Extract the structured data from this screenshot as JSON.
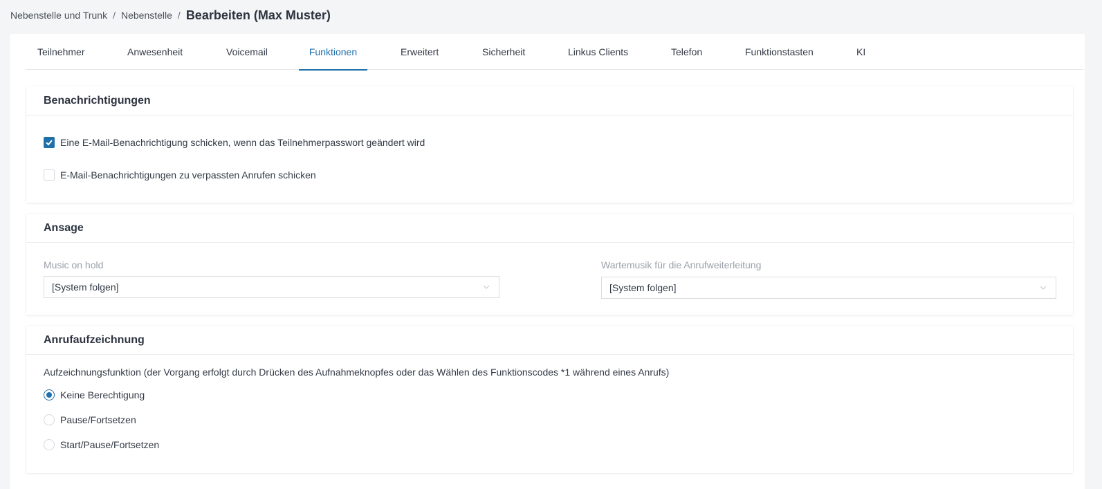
{
  "breadcrumb": {
    "items": [
      "Nebenstelle und Trunk",
      "Nebenstelle"
    ],
    "separator": "/",
    "current": "Bearbeiten (Max Muster)"
  },
  "tabs": [
    {
      "label": "Teilnehmer"
    },
    {
      "label": "Anwesenheit"
    },
    {
      "label": "Voicemail"
    },
    {
      "label": "Funktionen",
      "active": true
    },
    {
      "label": "Erweitert"
    },
    {
      "label": "Sicherheit"
    },
    {
      "label": "Linkus Clients"
    },
    {
      "label": "Telefon"
    },
    {
      "label": "Funktionstasten"
    },
    {
      "label": "KI"
    }
  ],
  "notifications": {
    "title": "Benachrichtigungen",
    "options": [
      {
        "label": "Eine E-Mail-Benachrichtigung schicken, wenn das Teilnehmerpasswort geändert wird",
        "checked": true
      },
      {
        "label": "E-Mail-Benachrichtigungen zu verpassten Anrufen schicken",
        "checked": false
      }
    ]
  },
  "announcement": {
    "title": "Ansage",
    "music_on_hold": {
      "label": "Music on hold",
      "value": "[System folgen]"
    },
    "forward_music": {
      "label": "Wartemusik für die Anrufweiterleitung",
      "value": "[System folgen]"
    }
  },
  "recording": {
    "title": "Anrufaufzeichnung",
    "description": "Aufzeichnungsfunktion (der Vorgang erfolgt durch Drücken des Aufnahmeknopfes oder das Wählen des Funktionscodes *1 während eines Anrufs)",
    "options": [
      {
        "label": "Keine Berechtigung",
        "checked": true
      },
      {
        "label": "Pause/Fortsetzen",
        "checked": false
      },
      {
        "label": "Start/Pause/Fortsetzen",
        "checked": false
      }
    ]
  },
  "colors": {
    "accent": "#1f6faa",
    "background": "#f3f5f7"
  },
  "icons": {
    "check": "check-icon",
    "select_arrow": "chevron-down-icon"
  }
}
